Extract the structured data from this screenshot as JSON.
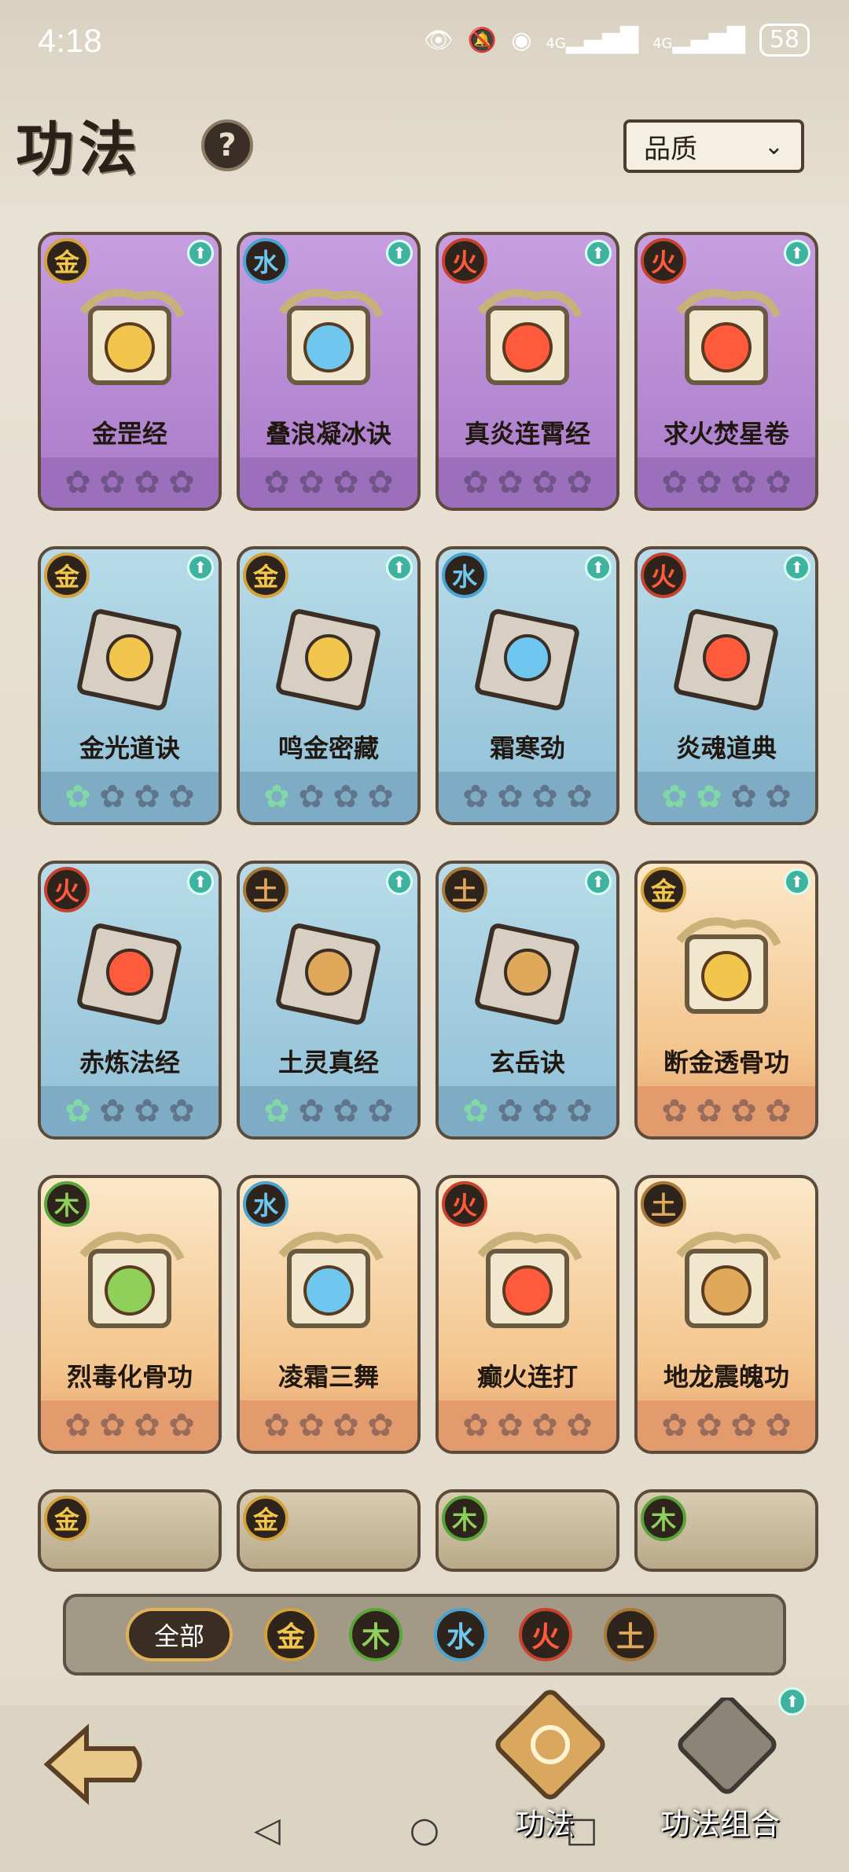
{
  "status": {
    "time": "4:18",
    "net1": "4G",
    "net2": "4G",
    "battery": "58"
  },
  "header": {
    "title": "功法",
    "help": "?",
    "sort_label": "品质"
  },
  "cards": [
    {
      "elem": "金",
      "ek": "jin",
      "name": "金罡经",
      "grade": "purple",
      "stars_on": 0
    },
    {
      "elem": "水",
      "ek": "shui",
      "name": "叠浪凝冰诀",
      "grade": "purple",
      "stars_on": 0
    },
    {
      "elem": "火",
      "ek": "huo",
      "name": "真炎连霄经",
      "grade": "purple",
      "stars_on": 0
    },
    {
      "elem": "火",
      "ek": "huo",
      "name": "求火焚星卷",
      "grade": "purple",
      "stars_on": 0
    },
    {
      "elem": "金",
      "ek": "jin",
      "name": "金光道诀",
      "grade": "blue",
      "stars_on": 1
    },
    {
      "elem": "金",
      "ek": "jin",
      "name": "鸣金密藏",
      "grade": "blue",
      "stars_on": 1
    },
    {
      "elem": "水",
      "ek": "shui",
      "name": "霜寒劲",
      "grade": "blue",
      "stars_on": 0
    },
    {
      "elem": "火",
      "ek": "huo",
      "name": "炎魂道典",
      "grade": "blue",
      "stars_on": 2
    },
    {
      "elem": "火",
      "ek": "huo",
      "name": "赤炼法经",
      "grade": "blue",
      "stars_on": 1
    },
    {
      "elem": "土",
      "ek": "tu",
      "name": "土灵真经",
      "grade": "blue",
      "stars_on": 1
    },
    {
      "elem": "土",
      "ek": "tu",
      "name": "玄岳诀",
      "grade": "blue",
      "stars_on": 1
    },
    {
      "elem": "金",
      "ek": "jin",
      "name": "断金透骨功",
      "grade": "orange",
      "stars_on": 0
    },
    {
      "elem": "木",
      "ek": "mu",
      "name": "烈毒化骨功",
      "grade": "orange",
      "stars_on": 0
    },
    {
      "elem": "水",
      "ek": "shui",
      "name": "凌霜三舞",
      "grade": "orange",
      "stars_on": 0
    },
    {
      "elem": "火",
      "ek": "huo",
      "name": "癫火连打",
      "grade": "orange",
      "stars_on": 0
    },
    {
      "elem": "土",
      "ek": "tu",
      "name": "地龙震魄功",
      "grade": "orange",
      "stars_on": 0
    },
    {
      "elem": "金",
      "ek": "jin",
      "name": "",
      "grade": "olive",
      "stars_on": 0
    },
    {
      "elem": "金",
      "ek": "jin",
      "name": "",
      "grade": "olive",
      "stars_on": 0
    },
    {
      "elem": "木",
      "ek": "mu",
      "name": "",
      "grade": "olive",
      "stars_on": 0
    },
    {
      "elem": "木",
      "ek": "mu",
      "name": "",
      "grade": "olive",
      "stars_on": 0
    }
  ],
  "filters": {
    "all": "全部",
    "jin": "金",
    "mu": "木",
    "shui": "水",
    "huo": "火",
    "tu": "土"
  },
  "bottom": {
    "tab1": "功法",
    "tab2": "功法组合"
  },
  "colors": {
    "jin": "#f2c54c",
    "mu": "#8ed05a",
    "shui": "#6fc6ef",
    "huo": "#ff5a3c",
    "tu": "#e0a85a"
  }
}
